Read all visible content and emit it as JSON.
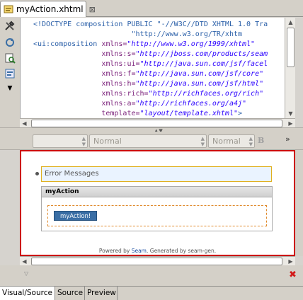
{
  "editor_tab": {
    "label": "myAction.xhtml",
    "close": "⊠"
  },
  "source_lines": [
    [
      {
        "c": "pi",
        "t": "<!DOCTYPE composition PUBLIC \"-//W3C//DTD XHTML 1.0 Tra"
      }
    ],
    [
      {
        "c": "pi",
        "t": "                       \"http://www.w3.org/TR/xhtm"
      }
    ],
    [
      {
        "c": "tag",
        "t": "<ui:composition "
      },
      {
        "c": "attr",
        "t": "xmlns="
      },
      {
        "c": "str",
        "t": "\"http://www.w3.org/1999/xhtml\""
      }
    ],
    [
      {
        "c": "",
        "t": "                "
      },
      {
        "c": "attr",
        "t": "xmlns:s="
      },
      {
        "c": "str",
        "t": "\"http://jboss.com/products/seam"
      }
    ],
    [
      {
        "c": "",
        "t": "                "
      },
      {
        "c": "attr",
        "t": "xmlns:ui="
      },
      {
        "c": "str",
        "t": "\"http://java.sun.com/jsf/facel"
      }
    ],
    [
      {
        "c": "",
        "t": "                "
      },
      {
        "c": "attr",
        "t": "xmlns:f="
      },
      {
        "c": "str",
        "t": "\"http://java.sun.com/jsf/core\""
      }
    ],
    [
      {
        "c": "",
        "t": "                "
      },
      {
        "c": "attr",
        "t": "xmlns:h="
      },
      {
        "c": "str",
        "t": "\"http://java.sun.com/jsf/html\""
      }
    ],
    [
      {
        "c": "",
        "t": "                "
      },
      {
        "c": "attr",
        "t": "xmlns:rich="
      },
      {
        "c": "str",
        "t": "\"http://richfaces.org/rich\""
      }
    ],
    [
      {
        "c": "",
        "t": "                "
      },
      {
        "c": "attr",
        "t": "xmlns:a="
      },
      {
        "c": "str",
        "t": "\"http://richfaces.org/a4j\""
      }
    ],
    [
      {
        "c": "",
        "t": "                "
      },
      {
        "c": "attr",
        "t": "template="
      },
      {
        "c": "str",
        "t": "\"layout/template.xhtml\""
      },
      {
        "c": "tag",
        "t": ">"
      }
    ]
  ],
  "format_toolbar": {
    "combo1": "",
    "combo2": "Normal",
    "combo3": "Normal",
    "bold": "B",
    "more": "»"
  },
  "visual": {
    "error_messages": "Error Messages",
    "panel_title": "myAction",
    "action_button": "myAction!",
    "powered_prefix": "Powered by ",
    "powered_link": "Seam",
    "powered_suffix": ". Generated by seam-gen."
  },
  "bottom_tabs": [
    "Visual/Source",
    "Source",
    "Preview"
  ]
}
